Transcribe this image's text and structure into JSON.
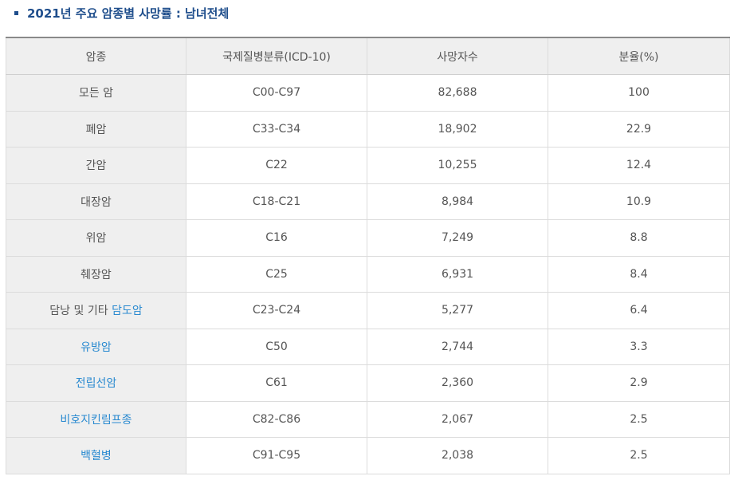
{
  "heading": "2021년 주요 암종별 사망률 : 남녀전체",
  "table": {
    "headers": [
      "암종",
      "국제질병분류(ICD-10)",
      "사망자수",
      "분율(%)"
    ],
    "rows": [
      {
        "name_prefix": "모든 암",
        "name_link": "",
        "icd": "C00-C97",
        "deaths": "82,688",
        "ratio": "100"
      },
      {
        "name_prefix": "폐암",
        "name_link": "",
        "icd": "C33-C34",
        "deaths": "18,902",
        "ratio": "22.9"
      },
      {
        "name_prefix": "간암",
        "name_link": "",
        "icd": "C22",
        "deaths": "10,255",
        "ratio": "12.4"
      },
      {
        "name_prefix": "대장암",
        "name_link": "",
        "icd": "C18-C21",
        "deaths": "8,984",
        "ratio": "10.9"
      },
      {
        "name_prefix": "위암",
        "name_link": "",
        "icd": "C16",
        "deaths": "7,249",
        "ratio": "8.8"
      },
      {
        "name_prefix": "췌장암",
        "name_link": "",
        "icd": "C25",
        "deaths": "6,931",
        "ratio": "8.4"
      },
      {
        "name_prefix": "담낭 및 기타 ",
        "name_link": "담도암",
        "icd": "C23-C24",
        "deaths": "5,277",
        "ratio": "6.4"
      },
      {
        "name_prefix": "",
        "name_link": "유방암",
        "icd": "C50",
        "deaths": "2,744",
        "ratio": "3.3"
      },
      {
        "name_prefix": "",
        "name_link": "전립선암",
        "icd": "C61",
        "deaths": "2,360",
        "ratio": "2.9"
      },
      {
        "name_prefix": "",
        "name_link": "비호지킨림프종",
        "icd": "C82-C86",
        "deaths": "2,067",
        "ratio": "2.5"
      },
      {
        "name_prefix": "",
        "name_link": "백혈병",
        "icd": "C91-C95",
        "deaths": "2,038",
        "ratio": "2.5"
      }
    ]
  },
  "colors": {
    "heading": "#1f4e8c",
    "link": "#2a8ad0",
    "header_bg": "#efefef",
    "text": "#555555"
  }
}
